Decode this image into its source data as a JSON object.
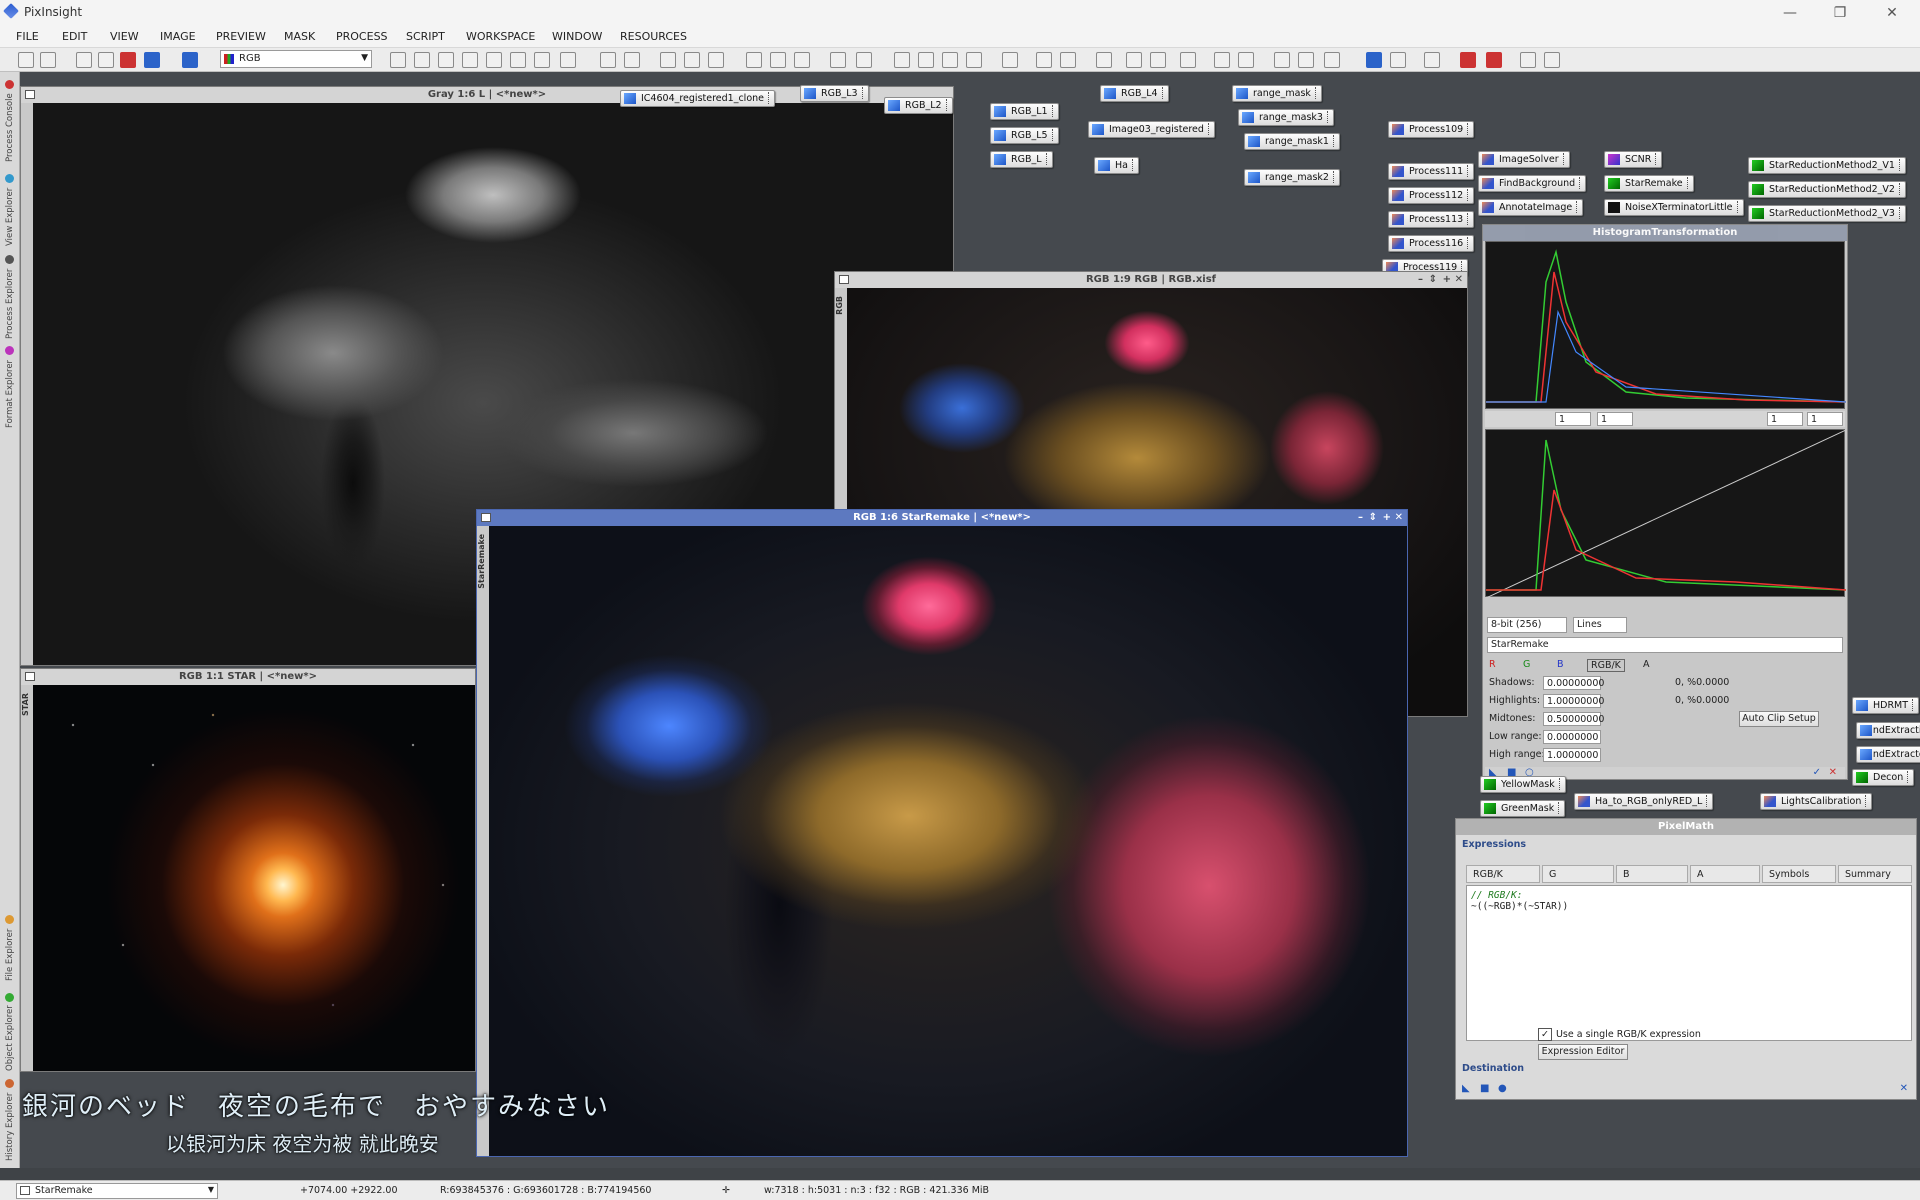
{
  "app": {
    "title": "PixInsight"
  },
  "menu": [
    "FILE",
    "EDIT",
    "VIEW",
    "IMAGE",
    "PREVIEW",
    "MASK",
    "PROCESS",
    "SCRIPT",
    "WORKSPACE",
    "WINDOW",
    "RESOURCES"
  ],
  "toolbar": {
    "channel": "RGB"
  },
  "left_dock": [
    "Process Console",
    "View Explorer",
    "Process Explorer",
    "Format Explorer",
    "File Explorer",
    "Object Explorer",
    "History Explorer"
  ],
  "windows": {
    "gray": {
      "title": "Gray 1:6 L | <*new*>"
    },
    "rgbxisf": {
      "title": "RGB 1:9 RGB | RGB.xisf",
      "side": "RGB"
    },
    "star": {
      "title": "RGB 1:1 STAR | <*new*>",
      "side": "STAR"
    },
    "starremake": {
      "title": "RGB 1:6 StarRemake | <*new*>",
      "side": "StarRemake"
    }
  },
  "icons": {
    "top": [
      "IC4604_registered1_clone",
      "RGB_L3",
      "RGB_L2",
      "RGB_L1",
      "RGB_L5",
      "RGB_L",
      "RGB_L4",
      "Image03_registered",
      "Ha",
      "range_mask",
      "range_mask3",
      "range_mask1",
      "range_mask2"
    ],
    "process": [
      "Process109",
      "Process111",
      "Process112",
      "Process113",
      "Process116",
      "Process119"
    ],
    "tools": [
      "ImageSolver",
      "FindBackground",
      "AnnotateImage",
      "SCNR",
      "StarRemake",
      "NoiseXTerminatorLittle",
      "StarReductionMethod2_V1",
      "StarReductionMethod2_V2",
      "StarReductionMethod2_V3",
      "YellowMask",
      "GreenMask",
      "Ha_to_RGB_onlyRED_L",
      "LightsCalibration",
      "HDRMT",
      "oundExtraction",
      "oundExtractor",
      "Decon"
    ]
  },
  "histogram": {
    "title": "HistogramTransformation",
    "zoom_h": "1",
    "zoom_v": "1",
    "zoom2_h": "1",
    "zoom2_v": "1",
    "bits": "8-bit (256)",
    "mode": "Lines",
    "target": "StarRemake",
    "channels": [
      "R",
      "G",
      "B",
      "RGB/K",
      "A"
    ],
    "shadows_label": "Shadows:",
    "shadows": "0.00000000",
    "shadows_pct": "0, %0.0000",
    "highlights_label": "Highlights:",
    "highlights": "1.00000000",
    "highlights_pct": "0, %0.0000",
    "midtones_label": "Midtones:",
    "midtones": "0.50000000",
    "low_label": "Low range:",
    "low": "0.0000000",
    "high_label": "High range:",
    "high": "1.0000000",
    "autoclip": "Auto Clip Setup"
  },
  "pixelmath": {
    "title": "PixelMath",
    "expressions": "Expressions",
    "tabs": [
      "RGB/K",
      "G",
      "B",
      "A",
      "Symbols",
      "Summary"
    ],
    "code_comment": "// RGB/K:",
    "code": "~((~RGB)*(~STAR))",
    "single_expr": "Use a single RGB/K expression",
    "expr_editor": "Expression Editor",
    "destination": "Destination"
  },
  "overlay": {
    "line1": "銀河のベッド　夜空の毛布で　おやすみなさい",
    "line2": "以银河为床  夜空为被  就此晚安"
  },
  "status": {
    "view": "StarRemake",
    "coords": "+7074.00  +2922.00",
    "rgb": "R:693845376 : G:693601728 : B:774194560",
    "info": "w:7318  :  h:5031  :  n:3  :  f32  :  RGB  :  421.336 MiB"
  }
}
